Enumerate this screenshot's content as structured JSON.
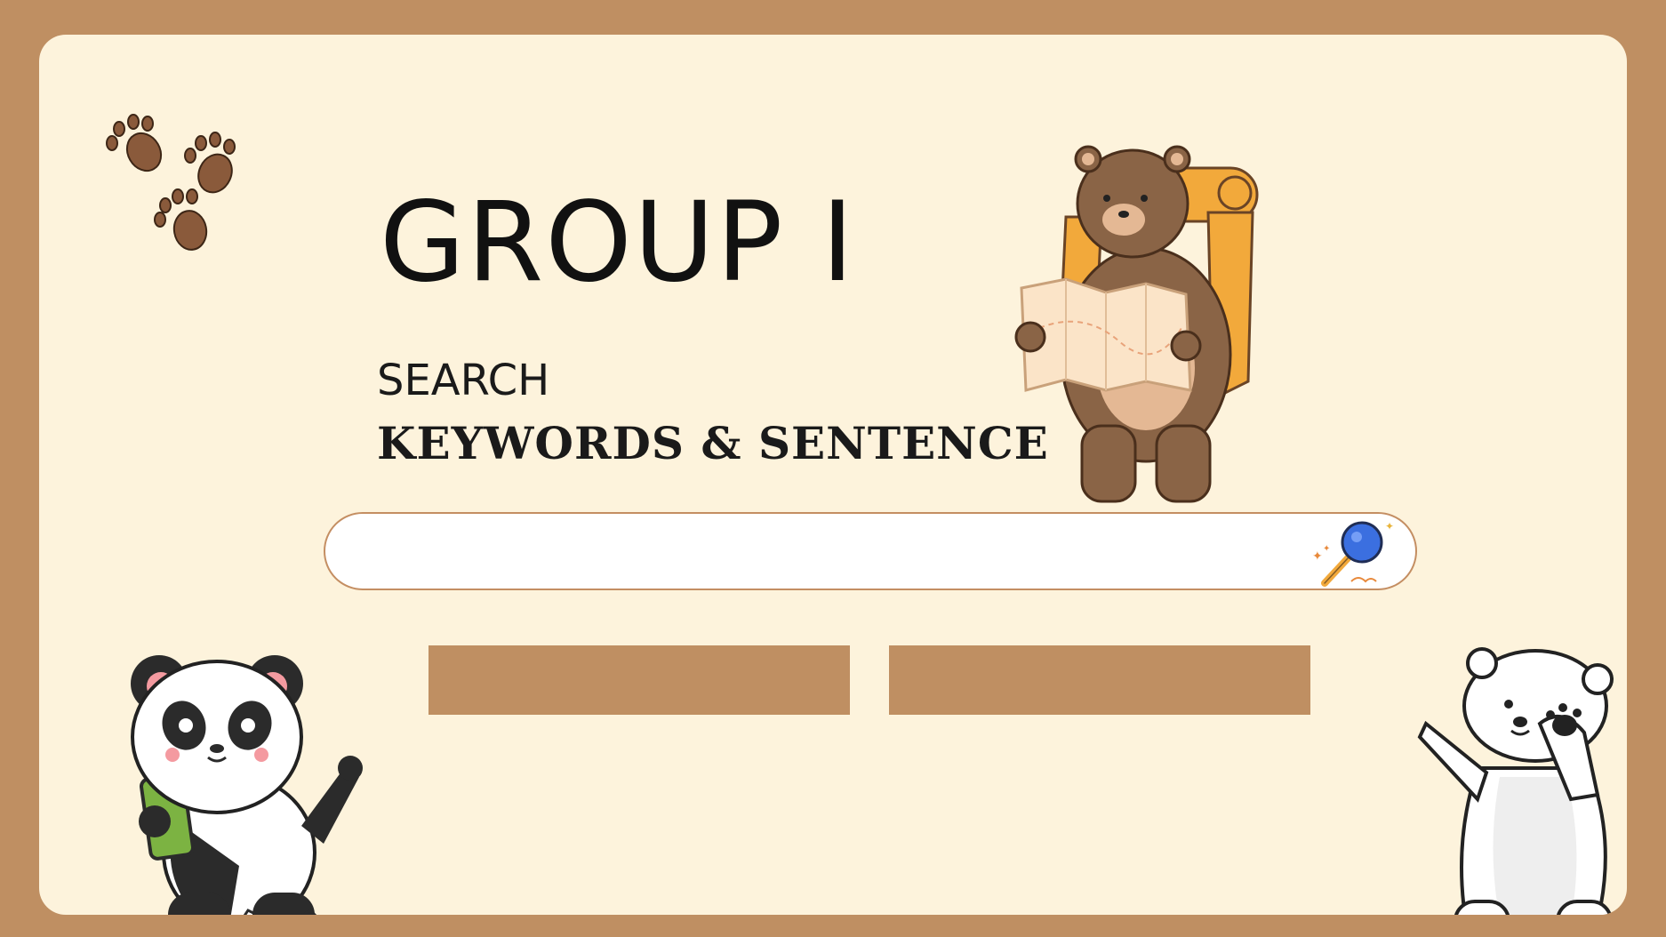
{
  "title": "GROUP I",
  "subtitle_line1": "SEARCH",
  "subtitle_line2": "KEYWORDS & SENTENCE",
  "search": {
    "value": "",
    "placeholder": ""
  },
  "buttons": [
    {
      "label": ""
    },
    {
      "label": ""
    }
  ],
  "colors": {
    "frame": "#bf8f62",
    "card_background": "#fdf3dc",
    "button": "#bf8f62",
    "search_border": "#c48e62",
    "magnifier_lens": "#3b6fe0",
    "magnifier_handle": "#f2a93b"
  },
  "icons": {
    "paws": "paw-prints-icon",
    "search": "magnifying-glass-icon"
  },
  "illustrations": {
    "top": "hiking-bear-with-map",
    "bottom_left": "panda-with-phone",
    "bottom_right": "dabbing-polar-bear"
  }
}
